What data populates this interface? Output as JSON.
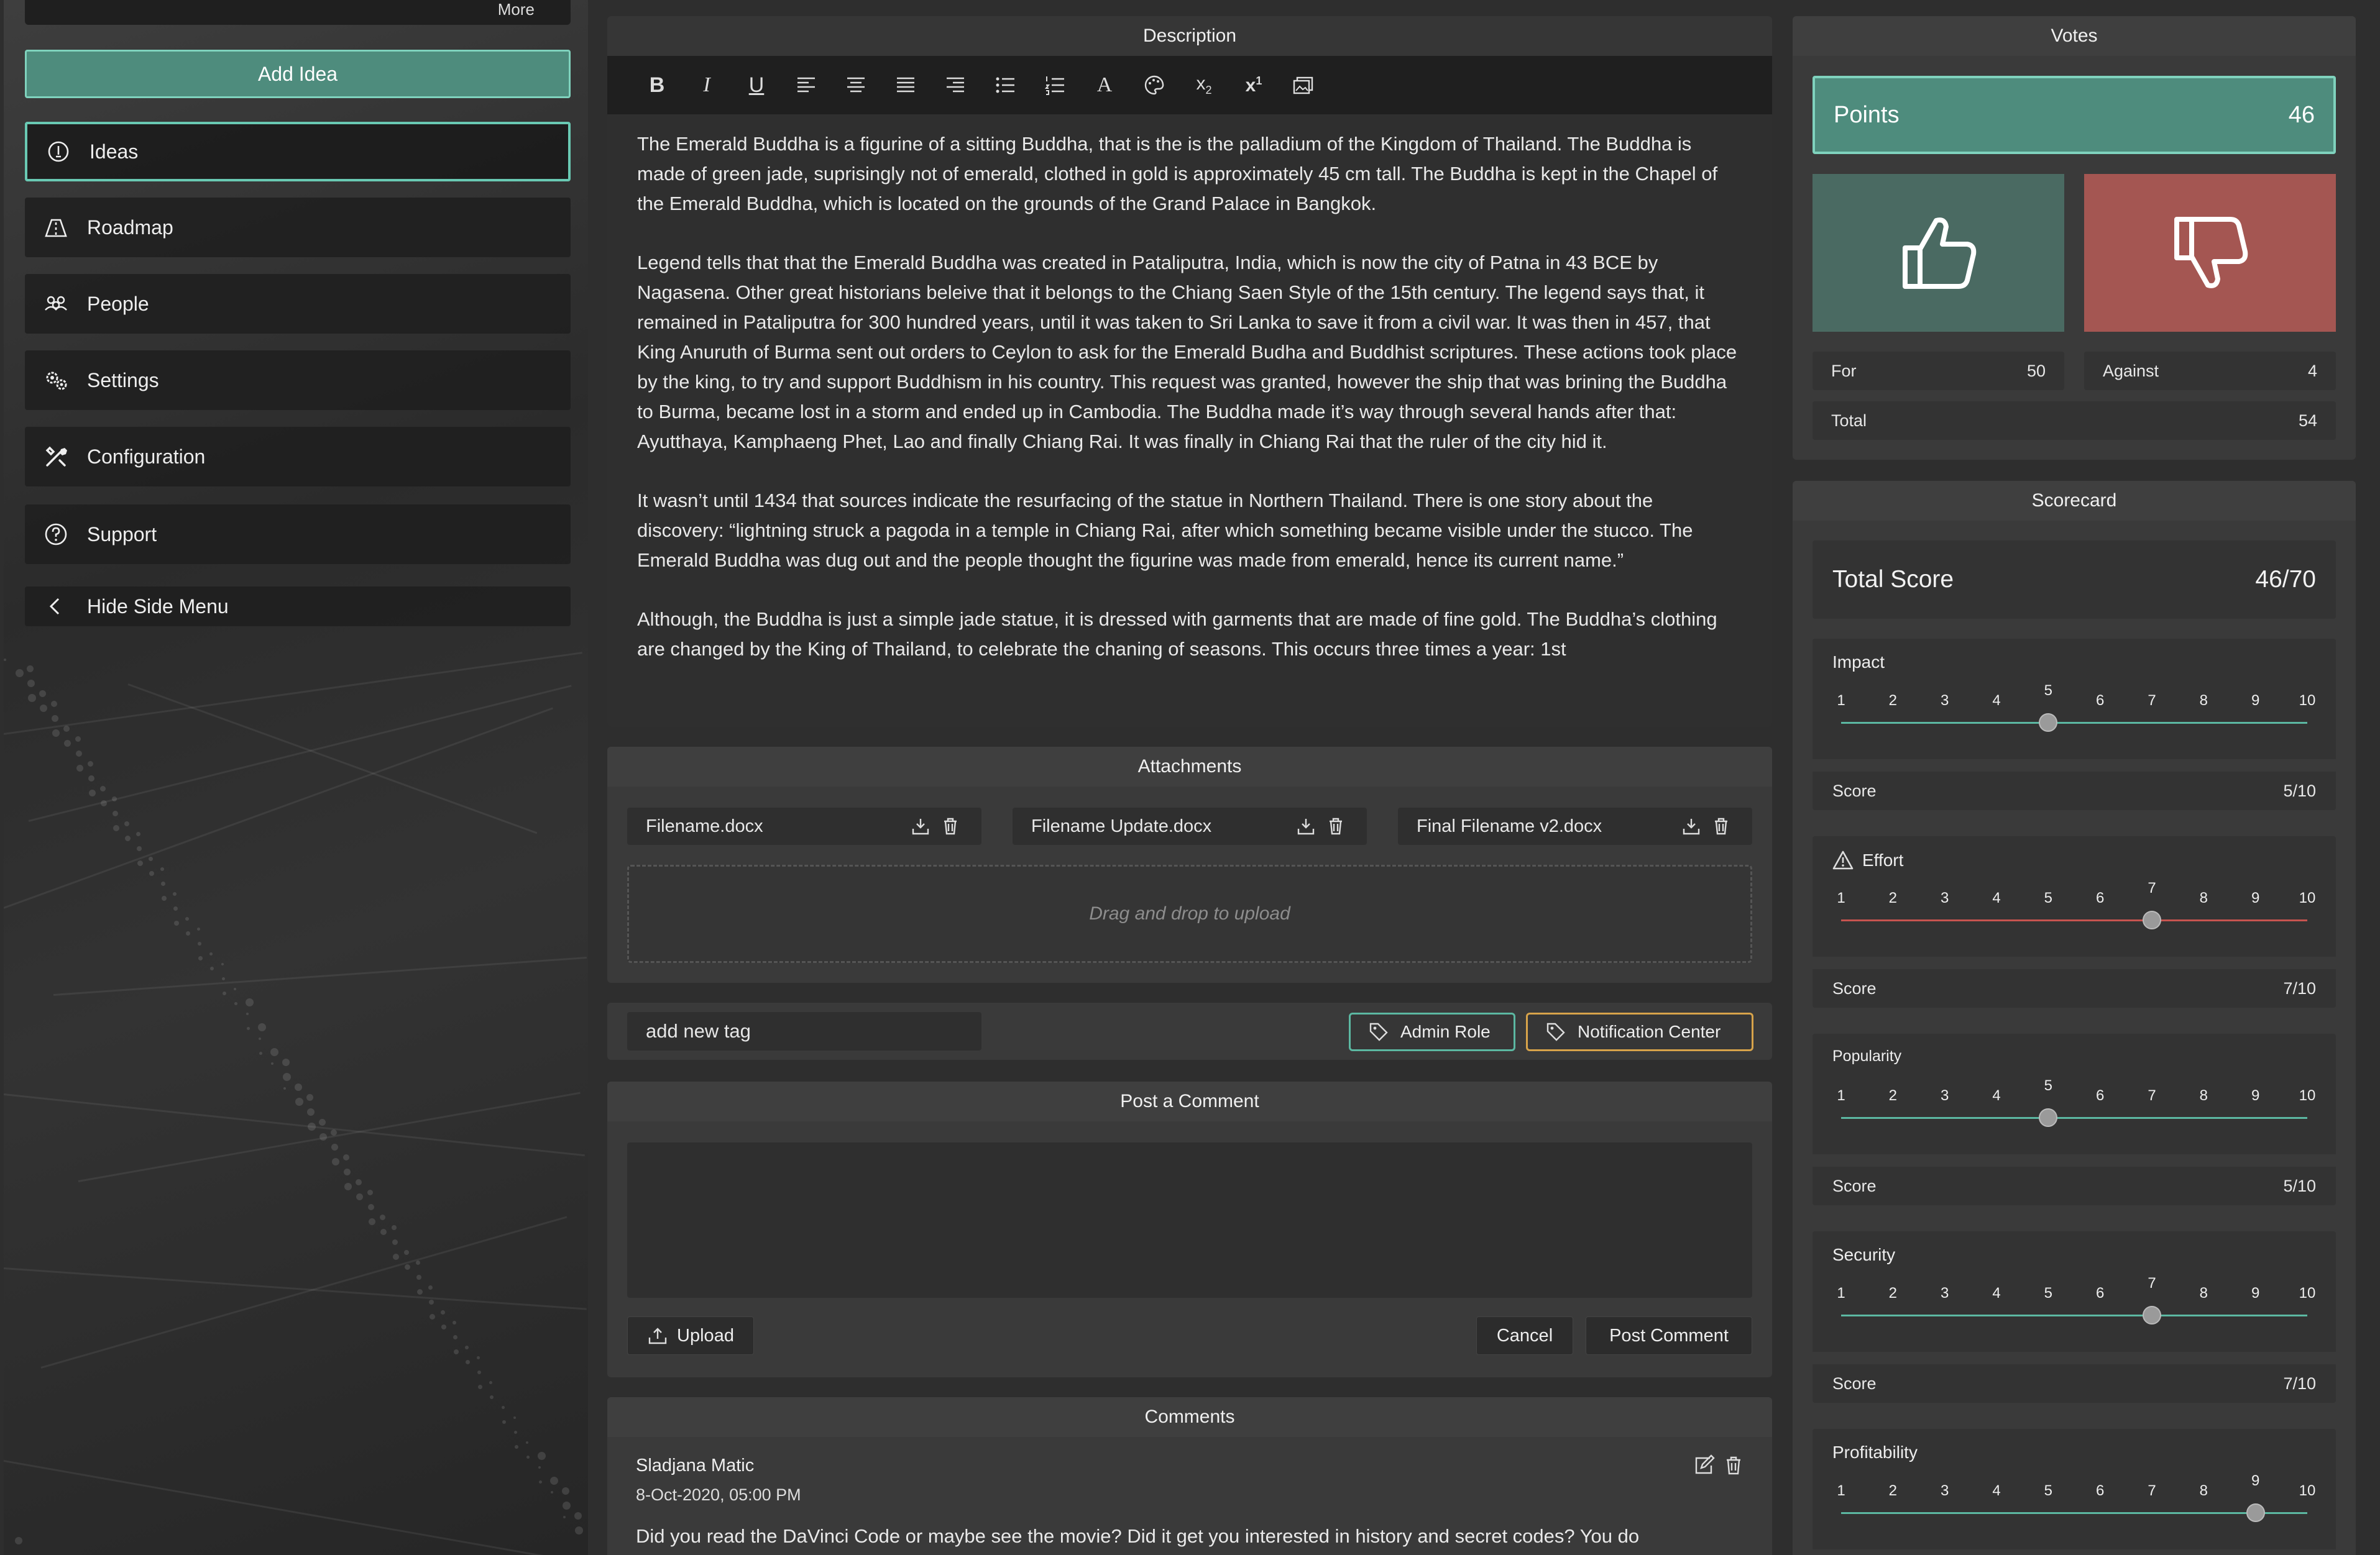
{
  "sidebar": {
    "more_label": "More",
    "add_idea_label": "Add Idea",
    "items": [
      {
        "label": "Ideas",
        "icon": "lightbulb-icon"
      },
      {
        "label": "Roadmap",
        "icon": "roadmap-icon"
      },
      {
        "label": "People",
        "icon": "people-icon"
      },
      {
        "label": "Settings",
        "icon": "gears-icon"
      },
      {
        "label": "Configuration",
        "icon": "tools-icon"
      },
      {
        "label": "Support",
        "icon": "help-icon"
      }
    ],
    "hide_label": "Hide Side Menu"
  },
  "description": {
    "title": "Description",
    "paragraphs": [
      "The Emerald Buddha is a figurine of a sitting Buddha, that is the is the palladium of the Kingdom of Thailand. The Buddha is made of green jade, suprisingly not of emerald, clothed in gold is approximately 45 cm tall. The Buddha is kept in the Chapel of the Emerald Buddha, which is located on the grounds of the Grand Palace in Bangkok.",
      "Legend tells that that the Emerald Buddha was created in Pataliputra, India, which is now the city of Patna in 43 BCE by Nagasena. Other great historians beleive that it belongs to the Chiang Saen Style of the 15th century. The legend says that, it remained in Pataliputra for 300 hundred years, until it was taken to Sri Lanka to save it from a civil war. It was then in 457, that King Anuruth of Burma sent out orders to Ceylon to ask for the Emerald Budha and Buddhist scriptures. These actions took place by the king, to try and support Buddhism in his country. This request was granted, however the ship that was brining the Buddha to Burma, became lost in a storm and ended up in Cambodia. The Buddha made it’s way through several hands after that: Ayutthaya, Kamphaeng Phet, Lao and finally Chiang Rai. It was finally in Chiang Rai that the ruler of the city hid it.",
      "It wasn’t until 1434 that sources indicate the resurfacing of the statue in Northern Thailand. There is one story about the discovery: “lightning struck a pagoda in a temple in Chiang Rai, after which something became visible under the stucco. The Emerald Buddha was dug out and the people thought the figurine was made from emerald, hence its current name.”",
      "Although, the Buddha is just a simple jade statue, it is dressed with garments that are made of fine gold. The Buddha’s clothing are changed by the King of Thailand, to celebrate the chaning of seasons. This occurs three times a year: 1st"
    ]
  },
  "attachments": {
    "title": "Attachments",
    "files": [
      "Filename.docx",
      "Filename Update.docx",
      "Final Filename v2.docx"
    ],
    "dropzone": "Drag and drop to upload"
  },
  "tags": {
    "placeholder": "add new tag",
    "items": [
      "Admin Role",
      "Notification Center"
    ]
  },
  "post_comment": {
    "title": "Post a Comment",
    "upload_label": "Upload",
    "cancel_label": "Cancel",
    "submit_label": "Post Comment"
  },
  "comments": {
    "title": "Comments",
    "items": [
      {
        "author": "Sladjana Matic",
        "date": "8-Oct-2020, 05:00 PM",
        "text": "Did you read the DaVinci Code or maybe see the movie? Did it get you interested in history and secret codes? You do"
      }
    ]
  },
  "votes": {
    "title": "Votes",
    "points_label": "Points",
    "points_value": "46",
    "for_label": "For",
    "for_value": "50",
    "against_label": "Against",
    "against_value": "4",
    "total_label": "Total",
    "total_value": "54",
    "colors": {
      "for": "#4a6a62",
      "against": "#a45652",
      "accent": "#4e8c7d"
    }
  },
  "scorecard": {
    "title": "Scorecard",
    "total_label": "Total Score",
    "total_value": "46/70",
    "score_label": "Score",
    "scale": [
      "1",
      "2",
      "3",
      "4",
      "5",
      "6",
      "7",
      "8",
      "9",
      "10"
    ],
    "criteria": [
      {
        "name": "Impact",
        "value": 5,
        "score": "5/10",
        "color": "#5cb8a2",
        "warn": false
      },
      {
        "name": "Effort",
        "value": 7,
        "score": "7/10",
        "color": "#c8544f",
        "warn": true
      },
      {
        "name": "Popularity",
        "value": 5,
        "score": "5/10",
        "color": "#5cb8a2",
        "warn": false
      },
      {
        "name": "Security",
        "value": 7,
        "score": "7/10",
        "color": "#5cb8a2",
        "warn": false
      },
      {
        "name": "Profitability",
        "value": 9,
        "score": "9/10",
        "color": "#5cb8a2",
        "warn": false
      }
    ]
  }
}
